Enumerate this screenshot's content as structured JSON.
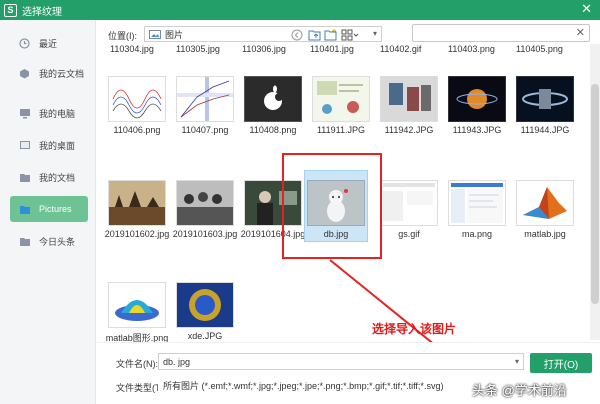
{
  "window": {
    "title": "选择纹理",
    "logo": "S",
    "close": "✕"
  },
  "toolbar": {
    "location_label": "位置(I):",
    "location_value": "图片",
    "search_clear": "✕"
  },
  "sidebar": {
    "items": [
      {
        "label": "最近",
        "icon": "clock-icon"
      },
      {
        "label": "我的云文档",
        "icon": "cloud-icon"
      },
      {
        "label": "我的电脑",
        "icon": "computer-icon"
      },
      {
        "label": "我的桌面",
        "icon": "desktop-icon"
      },
      {
        "label": "我的文档",
        "icon": "document-icon"
      },
      {
        "label": "Pictures",
        "icon": "folder-icon",
        "active": true
      },
      {
        "label": "今日头条",
        "icon": "folder-icon"
      }
    ]
  },
  "files": {
    "top_row_names": [
      "110304.jpg",
      "110305.jpg",
      "110306.jpg",
      "110401.jpg",
      "110402.gif",
      "110403.png",
      "110405.png"
    ],
    "row1": [
      "110406.png",
      "110407.png",
      "110408.png",
      "111911.JPG",
      "111942.JPG",
      "111943.JPG",
      "111944.JPG"
    ],
    "row2": [
      "2019101602.jpg",
      "2019101603.jpg",
      "2019101604.jpg",
      "db.jpg",
      "gs.gif",
      "ma.png",
      "matlab.jpg"
    ],
    "row3": [
      "matlab图形.png",
      "xde.JPG"
    ],
    "selected": "db.jpg"
  },
  "annotation": {
    "text": "选择导入该图片",
    "color": "#e11a1a"
  },
  "bottom": {
    "filename_label": "文件名(N):",
    "filename_value": "db. jpg",
    "filetype_label": "文件类型(T):",
    "filetype_value": "所有图片 (*.emf;*.wmf;*.jpg;*.jpeg;*.jpe;*.png;*.bmp;*.gif;*.tif;*.tiff;*.svg)",
    "open_button": "打开(O)"
  },
  "watermark": "头条 @学术前沿",
  "colors": {
    "brand": "#23a06a",
    "sidebar_active": "#6dc394",
    "selection": "#cde6f7"
  }
}
